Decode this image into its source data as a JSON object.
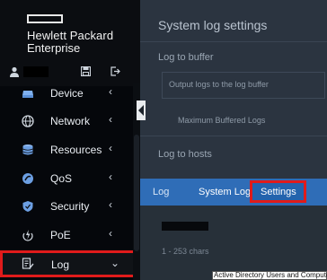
{
  "brand": {
    "line1": "Hewlett Packard",
    "line2": "Enterprise"
  },
  "nav": [
    {
      "label": "Device",
      "icon": "device-icon"
    },
    {
      "label": "Network",
      "icon": "globe-icon"
    },
    {
      "label": "Resources",
      "icon": "database-icon"
    },
    {
      "label": "QoS",
      "icon": "qos-icon"
    },
    {
      "label": "Security",
      "icon": "shield-icon"
    },
    {
      "label": "PoE",
      "icon": "power-icon"
    },
    {
      "label": "Log",
      "icon": "log-icon",
      "active": true
    }
  ],
  "chevrons": {
    "collapsed": "‹",
    "expanded": "⌄"
  },
  "main": {
    "title": "System log settings",
    "log_to_buffer": "Log to buffer",
    "output_logs": "Output logs to the log buffer",
    "max_logs": "Maximum Buffered Logs",
    "log_to_hosts": "Log to hosts",
    "hint": "1 - 253 chars"
  },
  "tabs": {
    "log": "Log",
    "system_log": "System Log",
    "settings": "Settings"
  },
  "tooltip": "Active Directory Users and Computers",
  "colors": {
    "accent_red": "#e01b1b",
    "tab_blue": "#2f6db7",
    "sidebar": "#05070b",
    "panel": "#2b3440"
  }
}
